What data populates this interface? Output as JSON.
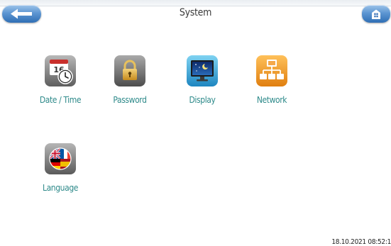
{
  "header": {
    "title": "System",
    "back_icon": "back-arrow-icon",
    "home_icon": "home-icon"
  },
  "tiles": [
    {
      "label": "Date / Time",
      "icon": "calendar-clock-icon"
    },
    {
      "label": "Password",
      "icon": "padlock-icon"
    },
    {
      "label": "Display",
      "icon": "monitor-icon"
    },
    {
      "label": "Network",
      "icon": "network-icon"
    },
    {
      "label": "Language",
      "icon": "flags-globe-icon"
    }
  ],
  "footer": {
    "timestamp": "18.10.2021 08:52:1"
  },
  "colors": {
    "accent": "#2e8a8a",
    "button": "#5e97d2"
  }
}
